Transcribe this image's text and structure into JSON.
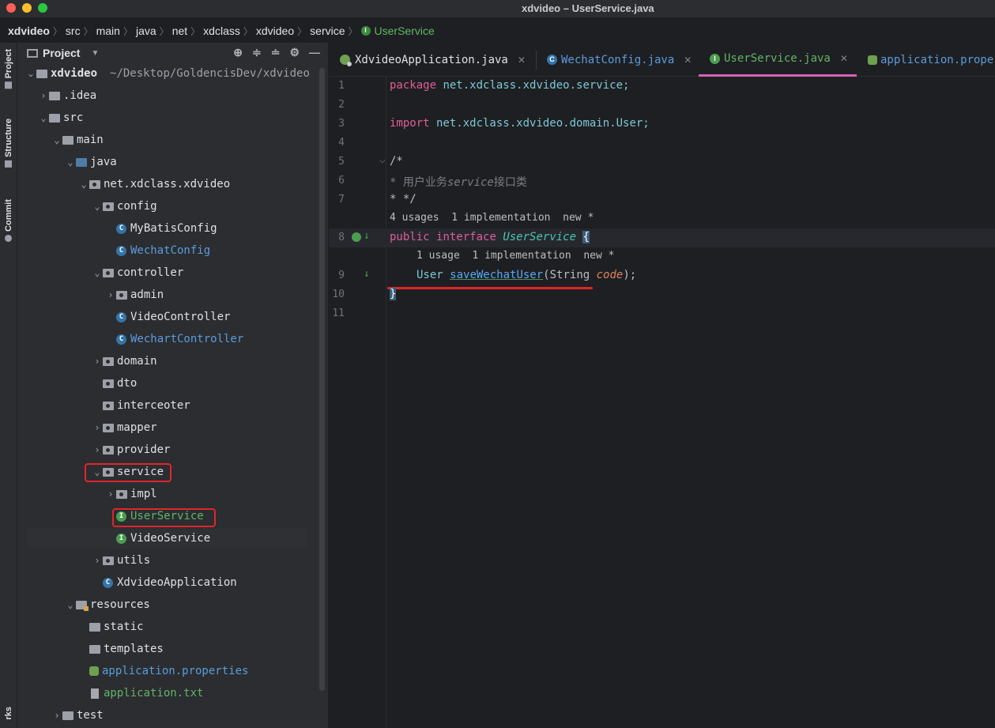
{
  "window": {
    "title": "xdvideo – UserService.java"
  },
  "breadcrumb": [
    "xdvideo",
    "src",
    "main",
    "java",
    "net",
    "xdclass",
    "xdvideo",
    "service",
    "UserService"
  ],
  "toolstrip": {
    "project": "Project",
    "structure": "Structure",
    "commit": "Commit",
    "bottom": "rks"
  },
  "panel": {
    "title": "Project"
  },
  "tree": [
    {
      "label": "xdvideo",
      "extra": "~/Desktop/GoldencisDev/xdvideo"
    },
    {
      "label": ".idea"
    },
    {
      "label": "src"
    },
    {
      "label": "main"
    },
    {
      "label": "java"
    },
    {
      "label": "net.xdclass.xdvideo"
    },
    {
      "label": "config"
    },
    {
      "label": "MyBatisConfig"
    },
    {
      "label": "WechatConfig"
    },
    {
      "label": "controller"
    },
    {
      "label": "admin"
    },
    {
      "label": "VideoController"
    },
    {
      "label": "WechartController"
    },
    {
      "label": "domain"
    },
    {
      "label": "dto"
    },
    {
      "label": "interceoter"
    },
    {
      "label": "mapper"
    },
    {
      "label": "provider"
    },
    {
      "label": "service"
    },
    {
      "label": "impl"
    },
    {
      "label": "UserService"
    },
    {
      "label": "VideoService"
    },
    {
      "label": "utils"
    },
    {
      "label": "XdvideoApplication"
    },
    {
      "label": "resources"
    },
    {
      "label": "static"
    },
    {
      "label": "templates"
    },
    {
      "label": "application.properties"
    },
    {
      "label": "application.txt"
    },
    {
      "label": "test"
    }
  ],
  "tabs": [
    {
      "label": "XdvideoApplication.java",
      "close": "✕"
    },
    {
      "label": "WechatConfig.java",
      "close": "✕"
    },
    {
      "label": "UserService.java",
      "close": "✕"
    },
    {
      "label": "application.prope"
    }
  ],
  "code": {
    "line_numbers": [
      "1",
      "2",
      "3",
      "4",
      "5",
      "6",
      "7",
      "8",
      "9",
      "10",
      "11"
    ],
    "l1_kw": "package",
    "l1_rest": " net.xdclass.xdvideo.service;",
    "l3_kw": "import",
    "l3_rest": " net.xdclass.xdvideo.domain.User;",
    "l5": "/*",
    "l6_a": "* 用户业务",
    "l6_b": "service",
    "l6_c": "接口类",
    "l7": "* */",
    "hint1": "4 usages  1 implementation  new *",
    "l8_kw1": "public",
    "l8_kw2": "interface",
    "l8_name": "UserService",
    "l8_brace": "{",
    "hint2": "1 usage  1 implementation  new *",
    "l9_type": "User ",
    "l9_method": "saveWechatUser",
    "l9_open": "(String ",
    "l9_param": "code",
    "l9_close": ");",
    "l10": "}"
  }
}
